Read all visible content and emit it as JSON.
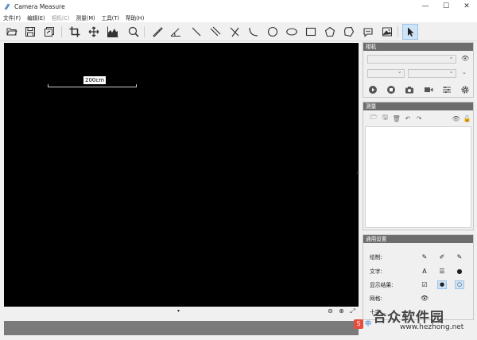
{
  "window": {
    "title": "Camera Measure",
    "controls": [
      "—",
      "☐",
      "✕"
    ]
  },
  "menu": [
    {
      "label": "文件(F)",
      "enabled": true
    },
    {
      "label": "编辑(E)",
      "enabled": true
    },
    {
      "label": "相机(C)",
      "enabled": false
    },
    {
      "label": "测量(M)",
      "enabled": true
    },
    {
      "label": "工具(T)",
      "enabled": true
    },
    {
      "label": "帮助(H)",
      "enabled": true
    }
  ],
  "toolbar": {
    "tools": [
      "open-folder",
      "save",
      "save-as",
      "crop",
      "move",
      "histogram",
      "zoom",
      "ruler",
      "angle",
      "line",
      "parallel-lines",
      "cross-lines",
      "arc",
      "circle",
      "ellipse",
      "rectangle",
      "pentagon",
      "polygon",
      "comment",
      "image",
      "pointer"
    ],
    "active": "pointer"
  },
  "canvas": {
    "scale_label": "200cm"
  },
  "camera_panel": {
    "title": "相机"
  },
  "measure_panel": {
    "title": "测量"
  },
  "settings_panel": {
    "title": "通用设置",
    "rows": [
      {
        "label": "绘制:"
      },
      {
        "label": "文字:"
      },
      {
        "label": "显示结果:"
      },
      {
        "label": "网格:"
      },
      {
        "label": "十字..."
      }
    ]
  },
  "watermark": {
    "logo": "合众软件园",
    "url": "www.hezhong.net",
    "s_badge": "S",
    "zh_badge": "中"
  },
  "colors": {
    "canvas": "#000000",
    "panel_header": "#6d6d6d",
    "accent": "#cfe3f7"
  }
}
